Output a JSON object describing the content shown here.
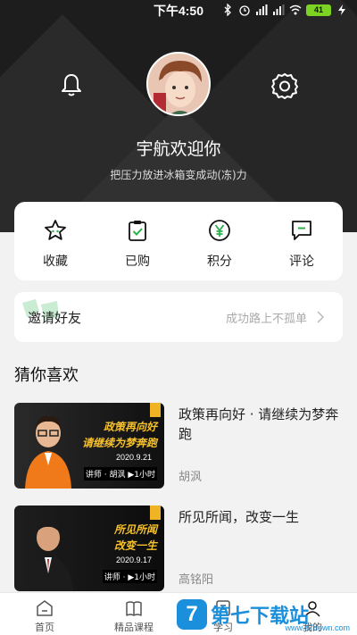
{
  "status_bar": {
    "time": "下午4:50",
    "battery": "41"
  },
  "profile": {
    "greeting": "宇航欢迎你",
    "motto": "把压力放进冰箱变成动(冻)力"
  },
  "quick_menu": [
    {
      "label": "收藏",
      "icon": "star-icon"
    },
    {
      "label": "已购",
      "icon": "clipboard-check-icon"
    },
    {
      "label": "积分",
      "icon": "yen-coin-icon"
    },
    {
      "label": "评论",
      "icon": "comment-icon"
    }
  ],
  "invite": {
    "title": "邀请好友",
    "slogan": "成功路上不孤单"
  },
  "recommend": {
    "title": "猜你喜欢",
    "courses": [
      {
        "title": "政策再向好 · 请继续为梦奔跑",
        "author": "胡沨",
        "thumb_line1": "政策再向好",
        "thumb_line2": "请继续为梦奔跑",
        "thumb_date": "2020.9.21",
        "thumb_teacher": "讲师 · 胡沨 ▶1小时"
      },
      {
        "title": "所见所闻，改变一生",
        "author": "高铭阳",
        "thumb_line1": "所见所闻",
        "thumb_line2": "改变一生",
        "thumb_date": "2020.9.17",
        "thumb_teacher": "讲师 · ▶1小时"
      }
    ]
  },
  "tabbar": [
    {
      "label": "首页",
      "icon": "home-icon"
    },
    {
      "label": "精品课程",
      "icon": "book-icon"
    },
    {
      "label": "学习",
      "icon": "study-icon"
    },
    {
      "label": "我的",
      "icon": "user-icon"
    }
  ],
  "watermark": {
    "badge": "7",
    "main": "第七下载站",
    "sub": "www.d7down.com"
  },
  "colors": {
    "accent": "#2bb24c",
    "header_bg": "#1d1d1d",
    "thumb_text": "#f6c12b"
  }
}
